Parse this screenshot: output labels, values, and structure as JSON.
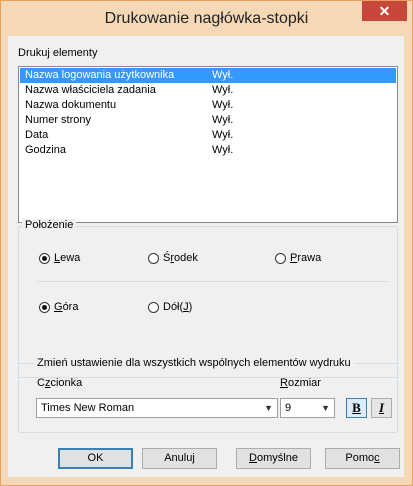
{
  "window": {
    "title": "Drukowanie nagłówka-stopki",
    "close_symbol": "✕"
  },
  "print_elements": {
    "label": "Drukuj elementy",
    "items": [
      {
        "name": "Nazwa logowania użytkownika",
        "value": "Wył."
      },
      {
        "name": "Nazwa właściciela zadania",
        "value": "Wył."
      },
      {
        "name": "Nazwa dokumentu",
        "value": "Wył."
      },
      {
        "name": "Numer strony",
        "value": "Wył."
      },
      {
        "name": "Data",
        "value": "Wył."
      },
      {
        "name": "Godzina",
        "value": "Wył."
      }
    ],
    "selected_index": 0
  },
  "position": {
    "title": "Położenie",
    "horizontal": [
      {
        "label_pre": "",
        "label_u": "L",
        "label_post": "ewa",
        "checked": true
      },
      {
        "label_pre": "Ś",
        "label_u": "r",
        "label_post": "odek",
        "checked": false
      },
      {
        "label_pre": "",
        "label_u": "P",
        "label_post": "rawa",
        "checked": false
      }
    ],
    "vertical": [
      {
        "label_pre": "",
        "label_u": "G",
        "label_post": "óra",
        "checked": true
      },
      {
        "label_pre": "Dół(",
        "label_u": "J",
        "label_post": ")",
        "checked": false
      }
    ]
  },
  "font_group": {
    "title": "Zmień ustawienie dla wszystkich wspólnych elementów wydruku",
    "font_label_pre": "C",
    "font_label_u": "z",
    "font_label_post": "cionka",
    "size_label_pre": "",
    "size_label_u": "R",
    "size_label_post": "ozmiar",
    "font_value": "Times New Roman",
    "size_value": "9",
    "bold_label": "B",
    "italic_label": "I"
  },
  "buttons": {
    "ok": "OK",
    "cancel": "Anuluj",
    "defaults_pre": "",
    "defaults_u": "D",
    "defaults_post": "omyślne",
    "help_pre": "Pomo",
    "help_u": "c",
    "help_post": ""
  },
  "colors": {
    "selection": "#3399ff",
    "close": "#c7473a",
    "frame": "#f5d9b7"
  }
}
